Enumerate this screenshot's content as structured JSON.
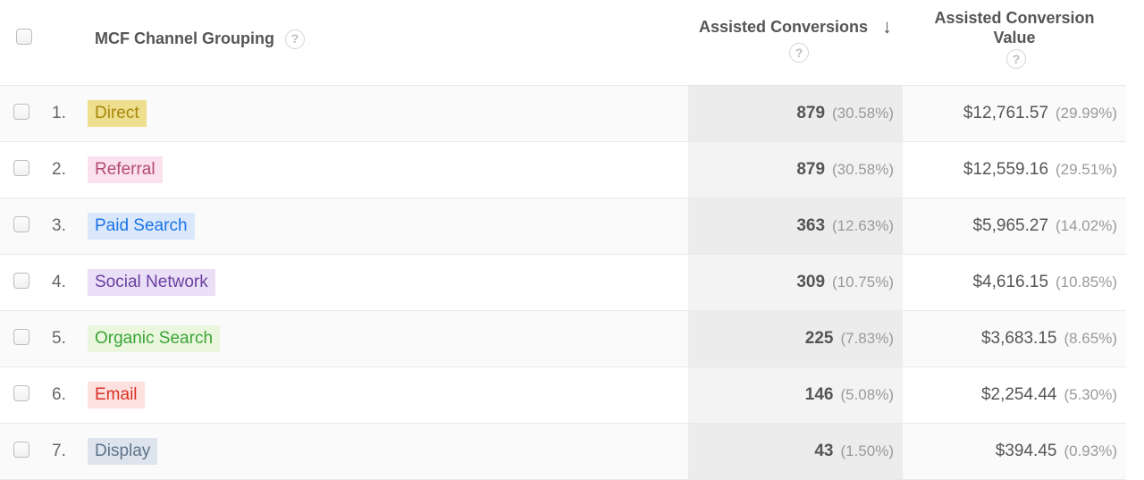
{
  "columns": {
    "channel_label": "MCF Channel Grouping",
    "assisted_conversions": "Assisted Conversions",
    "assisted_conversion_value": "Assisted Conversion\nValue"
  },
  "rows": [
    {
      "index": "1.",
      "name": "Direct",
      "tag_bg": "#eedf8f",
      "tag_fg": "#a8860b",
      "conv": "879",
      "conv_pct": "(30.58%)",
      "val": "$12,761.57",
      "val_pct": "(29.99%)"
    },
    {
      "index": "2.",
      "name": "Referral",
      "tag_bg": "#fbe1ed",
      "tag_fg": "#b14a73",
      "conv": "879",
      "conv_pct": "(30.58%)",
      "val": "$12,559.16",
      "val_pct": "(29.51%)"
    },
    {
      "index": "3.",
      "name": "Paid Search",
      "tag_bg": "#dbe8fb",
      "tag_fg": "#1a73e8",
      "conv": "363",
      "conv_pct": "(12.63%)",
      "val": "$5,965.27",
      "val_pct": "(14.02%)"
    },
    {
      "index": "4.",
      "name": "Social Network",
      "tag_bg": "#e9dff7",
      "tag_fg": "#6b3fa0",
      "conv": "309",
      "conv_pct": "(10.75%)",
      "val": "$4,616.15",
      "val_pct": "(10.85%)"
    },
    {
      "index": "5.",
      "name": "Organic Search",
      "tag_bg": "#eaf6de",
      "tag_fg": "#3aa537",
      "conv": "225",
      "conv_pct": "(7.83%)",
      "val": "$3,683.15",
      "val_pct": "(8.65%)"
    },
    {
      "index": "6.",
      "name": "Email",
      "tag_bg": "#fde1de",
      "tag_fg": "#d93025",
      "conv": "146",
      "conv_pct": "(5.08%)",
      "val": "$2,254.44",
      "val_pct": "(5.30%)"
    },
    {
      "index": "7.",
      "name": "Display",
      "tag_bg": "#dde4ed",
      "tag_fg": "#5f7389",
      "conv": "43",
      "conv_pct": "(1.50%)",
      "val": "$394.45",
      "val_pct": "(0.93%)"
    }
  ]
}
